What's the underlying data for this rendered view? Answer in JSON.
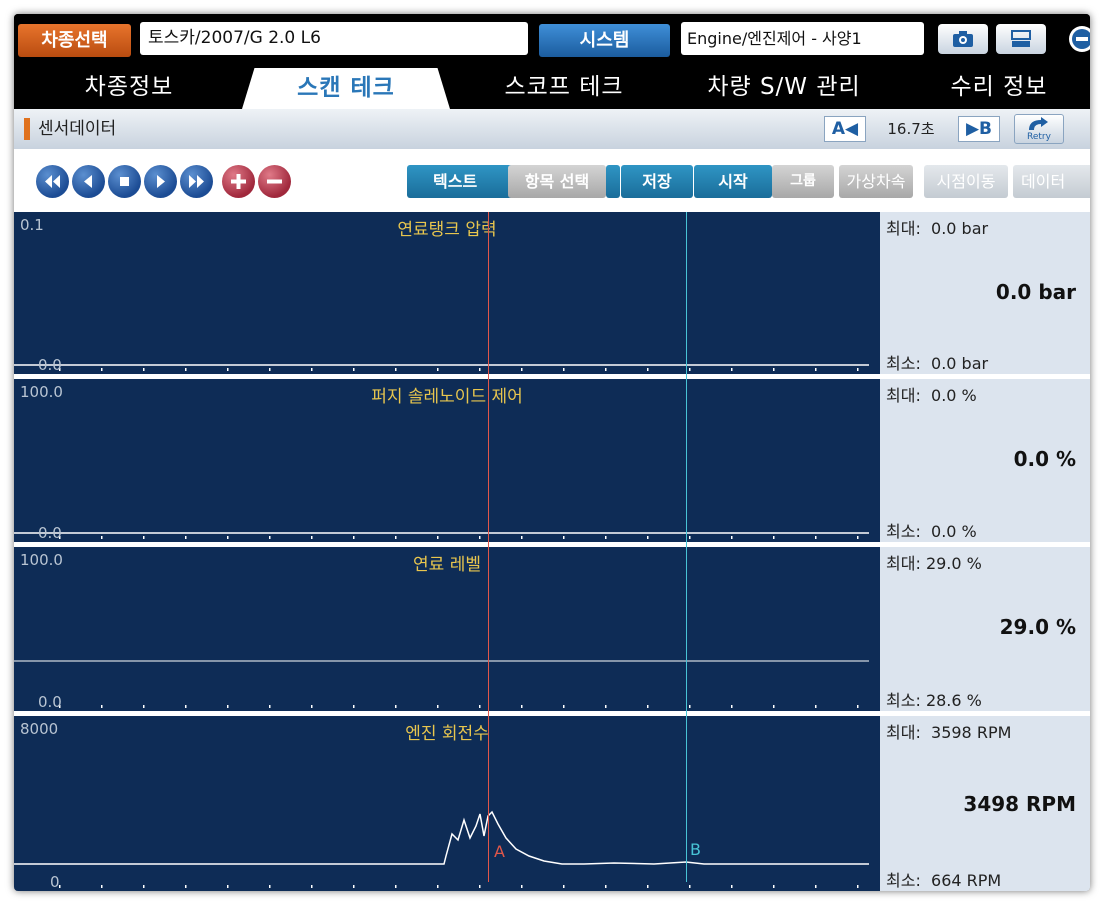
{
  "header": {
    "vehicle_button": "차종선택",
    "vehicle_value": "토스카/2007/G 2.0 L6",
    "system_button": "시스템",
    "system_value": "Engine/엔진제어 - 사양1",
    "icons": [
      "camera-icon",
      "display-icon",
      "exit-icon"
    ]
  },
  "tabs": [
    {
      "label": "차종정보",
      "active": false
    },
    {
      "label": "스캔 테크",
      "active": true
    },
    {
      "label": "스코프 테크",
      "active": false
    },
    {
      "label": "차량 S/W 관리",
      "active": false
    },
    {
      "label": "수리 정보",
      "active": false
    }
  ],
  "section": {
    "title": "센서데이터",
    "cursor_a": "A◀",
    "cursor_time": "16.7초",
    "cursor_b": "▶B",
    "retry": "Retry"
  },
  "toolbar": {
    "nav_icons": [
      "rewind-icon",
      "step-back-icon",
      "stop-icon",
      "play-icon",
      "fast-forward-icon",
      "zoom-in-icon",
      "zoom-out-icon"
    ],
    "text_button": "텍스트",
    "item_select": "항목 선택",
    "save": "저장",
    "start": "시작",
    "group": "그룹",
    "virtual_speed": "가상차속",
    "time_shift": "시점이동",
    "data": "데이터"
  },
  "cursors": {
    "a": "A",
    "b": "B"
  },
  "graphs": [
    {
      "title": "연료탱크 압력",
      "scale_max": "0.1",
      "scale_min": "0.0",
      "max_label": "최대:",
      "max_value": "0.0 bar",
      "current": "0.0 bar",
      "min_label": "최소:",
      "min_value": "0.0 bar"
    },
    {
      "title": "퍼지 솔레노이드 제어",
      "scale_max": "100.0",
      "scale_min": "0.0",
      "max_label": "최대:",
      "max_value": "0.0 %",
      "current": "0.0 %",
      "min_label": "최소:",
      "min_value": "0.0 %"
    },
    {
      "title": "연료 레벨",
      "scale_max": "100.0",
      "scale_min": "0.0",
      "max_label": "최대:",
      "max_value": "29.0 %",
      "current": "29.0 %",
      "min_label": "최소:",
      "min_value": "28.6 %"
    },
    {
      "title": "엔진 회전수",
      "scale_max": "8000",
      "scale_min": "0",
      "max_label": "최대:",
      "max_value": "3598 RPM",
      "current": "3498 RPM",
      "min_label": "최소:",
      "min_value": "664 RPM"
    }
  ],
  "colors": {
    "graph_bg": "#0e2c56",
    "title": "#e8c64e",
    "cursor_a": "#e0574a",
    "cursor_b": "#48c4d6",
    "accent_orange": "#e0721e",
    "accent_blue": "#1b5c9e"
  }
}
